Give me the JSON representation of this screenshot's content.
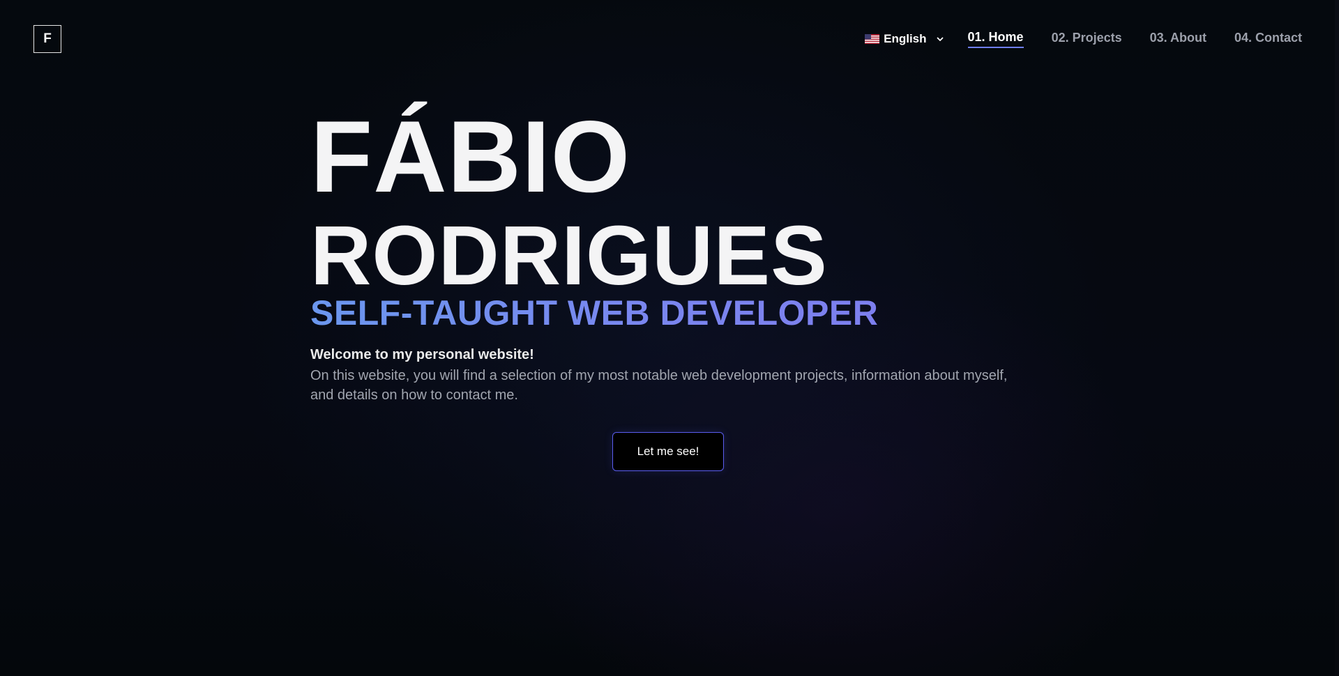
{
  "logo": {
    "letter": "F"
  },
  "language": {
    "flag_icon": "us-flag-icon",
    "selected": "English"
  },
  "nav": {
    "items": [
      {
        "label": "01. Home",
        "active": true
      },
      {
        "label": "02. Projects",
        "active": false
      },
      {
        "label": "03. About",
        "active": false
      },
      {
        "label": "04. Contact",
        "active": false
      }
    ]
  },
  "hero": {
    "first_name": "FÁBIO",
    "last_name": "RODRIGUES",
    "subtitle": "SELF-TAUGHT WEB DEVELOPER",
    "welcome": "Welcome to my personal website!",
    "intro": "On this website, you will find a selection of my most notable web development projects, information about myself, and details on how to contact me.",
    "cta_label": "Let me see!"
  },
  "colors": {
    "accent_start": "#6b97ee",
    "accent_end": "#7d7fee",
    "button_border": "#5a5df0",
    "background": "#05080c"
  }
}
